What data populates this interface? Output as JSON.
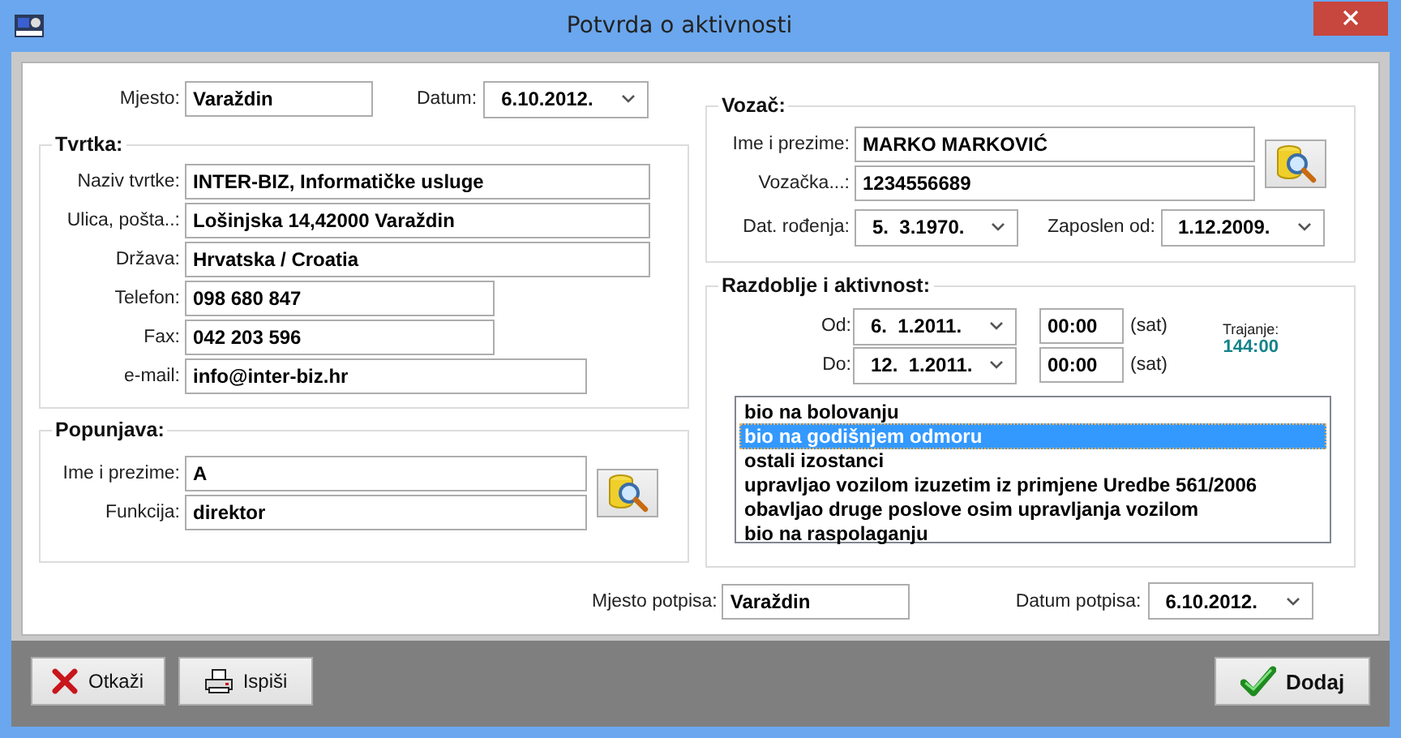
{
  "window": {
    "title": "Potvrda o aktivnosti"
  },
  "header": {
    "place": {
      "label": "Mjesto:",
      "value": "Varaždin"
    },
    "date": {
      "label": "Datum:",
      "value": "6.10.2012."
    }
  },
  "company": {
    "title": "Tvrtka:",
    "fields": [
      {
        "label": "Naziv tvrtke:",
        "value": "INTER-BIZ, Informatičke usluge"
      },
      {
        "label": "Ulica, pošta..:",
        "value": "Lošinjska 14,42000 Varaždin"
      },
      {
        "label": "Država:",
        "value": "Hrvatska / Croatia"
      },
      {
        "label": "Telefon:",
        "value": "098 680 847"
      },
      {
        "label": "Fax:",
        "value": "042 203 596"
      },
      {
        "label": "e-mail:",
        "value": "info@inter-biz.hr"
      }
    ]
  },
  "filler": {
    "title": "Popunjava:",
    "fields": [
      {
        "label": "Ime i prezime:",
        "value": "A"
      },
      {
        "label": "Funkcija:",
        "value": "direktor"
      }
    ]
  },
  "driver": {
    "title": "Vozač:",
    "fields": [
      {
        "label": "Ime i prezime:",
        "value": "MARKO MARKOVIĆ"
      },
      {
        "label": "Vozačka...:",
        "value": "1234556689"
      }
    ],
    "dates": [
      {
        "label": "Dat. rođenja:",
        "value": "5.  3.1970."
      },
      {
        "label": "Zaposlen od:",
        "value": "1.12.2009."
      }
    ]
  },
  "period": {
    "title": "Razdoblje i aktivnost:",
    "rows": [
      {
        "label": "Od:",
        "date": "6.  1.2011.",
        "time": "00:00",
        "unit": "(sat)"
      },
      {
        "label": "Do:",
        "date": "12.  1.2011.",
        "time": "00:00",
        "unit": "(sat)"
      }
    ],
    "duration": {
      "label": "Trajanje:",
      "value": "144:00"
    },
    "activities": [
      {
        "label": "bio na bolovanju",
        "selected": false
      },
      {
        "label": "bio na godišnjem odmoru",
        "selected": true
      },
      {
        "label": "ostali izostanci",
        "selected": false
      },
      {
        "label": "upravljao vozilom izuzetim iz primjene Uredbe 561/2006",
        "selected": false
      },
      {
        "label": "obavljao druge poslove osim upravljanja vozilom",
        "selected": false
      },
      {
        "label": "bio na raspolaganju",
        "selected": false
      }
    ]
  },
  "signature": {
    "place": {
      "label": "Mjesto potpisa:",
      "value": "Varaždin"
    },
    "date": {
      "label": "Datum potpisa:",
      "value": "6.10.2012."
    }
  },
  "buttons": [
    {
      "label": "Otkaži",
      "kind": "cancel"
    },
    {
      "label": "Ispiši",
      "kind": "print"
    },
    {
      "label": "Dodaj",
      "kind": "add"
    }
  ]
}
